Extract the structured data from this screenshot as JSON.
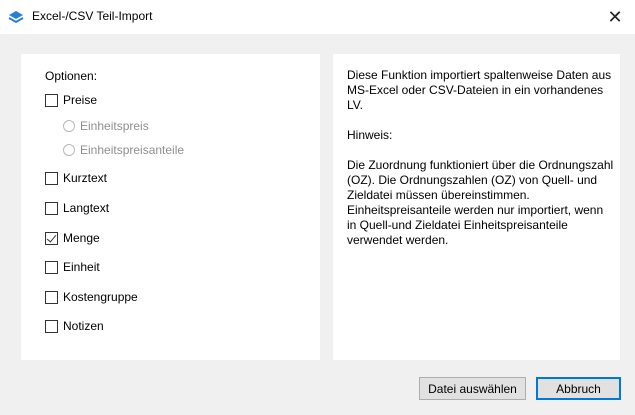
{
  "window": {
    "title": "Excel-/CSV Teil-Import",
    "close_symbol": "✕",
    "icon": "app-logo-icon"
  },
  "options": {
    "heading": "Optionen:",
    "items": [
      {
        "label": "Preise",
        "checked": false
      },
      {
        "label": "Kurztext",
        "checked": false
      },
      {
        "label": "Langtext",
        "checked": false
      },
      {
        "label": "Menge",
        "checked": true
      },
      {
        "label": "Einheit",
        "checked": false
      },
      {
        "label": "Kostengruppe",
        "checked": false
      },
      {
        "label": "Notizen",
        "checked": false
      }
    ],
    "radios": [
      {
        "label": "Einheitspreis",
        "disabled": true
      },
      {
        "label": "Einheitspreisanteile",
        "disabled": true
      }
    ]
  },
  "info": {
    "text": "Diese Funktion importiert spaltenweise Daten aus MS-Excel oder CSV-Dateien in ein vorhandenes LV.\n\nHinweis:\n\nDie Zuordnung funktioniert über die Ordnungszahl (OZ). Die Ordnungszahlen (OZ) von Quell- und Zieldatei müssen übereinstimmen.\nEinheitspreisanteile werden nur importiert, wenn in Quell-und Zieldatei Einheitspreisanteile verwendet werden."
  },
  "buttons": {
    "file": "Datei auswählen",
    "cancel": "Abbruch"
  },
  "colors": {
    "accent": "#0078d7",
    "background": "#f0f0f0"
  }
}
